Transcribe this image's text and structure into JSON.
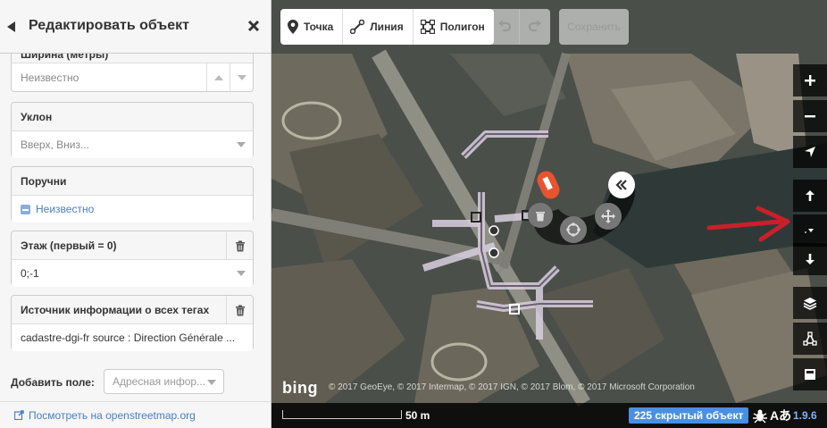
{
  "sidebar": {
    "title": "Редактировать объект",
    "fields": {
      "width": {
        "label": "Ширина (метры)",
        "placeholder": "Неизвестно"
      },
      "incline": {
        "label": "Уклон",
        "placeholder": "Вверх, Вниз..."
      },
      "handrail": {
        "label": "Поручни",
        "value": "Неизвестно"
      },
      "level": {
        "label": "Этаж (первый = 0)",
        "value": "0;-1"
      },
      "source": {
        "label": "Источник информации о всех тегах",
        "value": "cadastre-dgi-fr source : Direction Générale ..."
      }
    },
    "add_field": {
      "label": "Добавить поле:",
      "placeholder": "Адресная инфор..."
    },
    "osm_link": "Посмотреть на openstreetmap.org"
  },
  "toolbar": {
    "point": "Точка",
    "line": "Линия",
    "polygon": "Полигон",
    "save": "Сохранить"
  },
  "map": {
    "attribution": "© 2017 GeoEye, © 2017 Intermap, © 2017 IGN, © 2017 Blom, © 2017 Microsoft Corporation",
    "bing": "bing",
    "scale": "50 m",
    "hidden_count": "225 скрытый объект",
    "version": "1.9.6",
    "lang_glyph": "Aあ"
  },
  "colors": {
    "accent": "#4a90e2",
    "link": "#4a7ec2",
    "arrow": "#c9202a"
  },
  "icons": [
    "back-icon",
    "close-icon",
    "point-icon",
    "line-icon",
    "polygon-icon",
    "undo-icon",
    "redo-icon",
    "zoom-in-icon",
    "zoom-out-icon",
    "locate-icon",
    "up-icon",
    "down-icon",
    "layers-icon",
    "map-data-icon",
    "help-icon",
    "trash-icon",
    "bug-icon",
    "external-link-icon",
    "collapse-icon",
    "delete-icon",
    "circularize-icon",
    "move-icon"
  ]
}
